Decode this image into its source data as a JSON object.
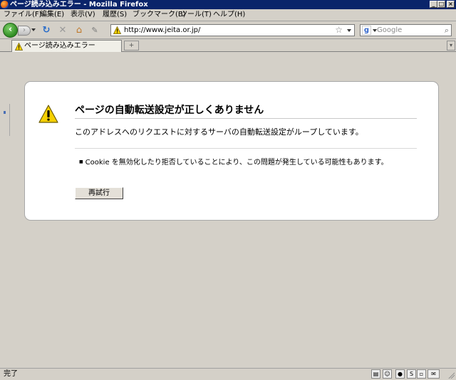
{
  "window": {
    "title": "ページ読み込みエラー - Mozilla Firefox",
    "controls": [
      "_",
      "□",
      "×"
    ]
  },
  "menu": {
    "items": [
      "ファイル(F)",
      "編集(E)",
      "表示(V)",
      "履歴(S)",
      "ブックマーク(B)",
      "ツール(T)",
      "ヘルプ(H)"
    ]
  },
  "navbar": {
    "url": "http://www.jeita.or.jp/",
    "search_placeholder": "Google"
  },
  "tabs": {
    "active_label": "ページ読み込みエラー",
    "new_tab": "+"
  },
  "error": {
    "title": "ページの自動転送設定が正しくありません",
    "description": "このアドレスへのリクエストに対するサーバの自動転送設定がループしています。",
    "bullet": "Cookie を無効化したり拒否していることにより、この問題が発生している可能性もあります。",
    "retry_label": "再試行"
  },
  "status": {
    "text": "完了"
  },
  "colors": {
    "titlebar": "#0a246a",
    "chrome": "#d4d0c8",
    "warning": "#f5d000"
  }
}
